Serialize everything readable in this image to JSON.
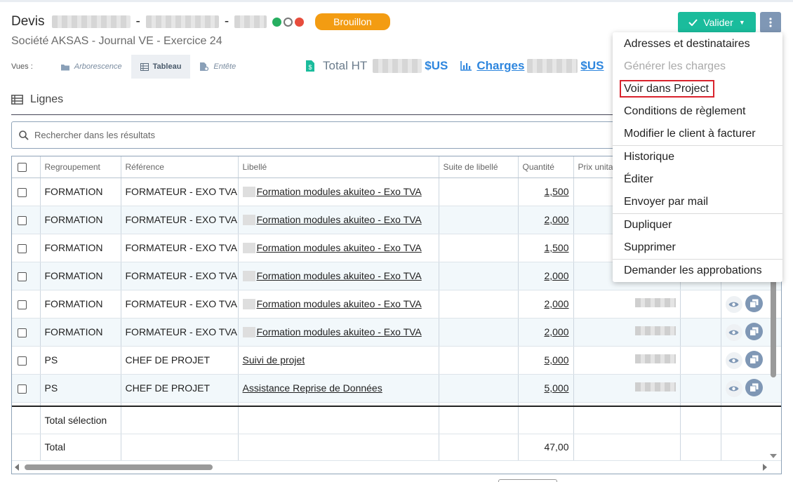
{
  "header": {
    "title_prefix": "Devis",
    "separator": "-",
    "status_badge": "Brouillon",
    "subtitle": "Société AKSAS  -  Journal VE  -  Exercice 24",
    "status_dots": [
      "#27ae60",
      "#ffffff",
      "#e74c3c"
    ]
  },
  "views": {
    "label": "Vues :",
    "items": [
      {
        "label": "Arborescence",
        "icon": "folder-icon",
        "active": false
      },
      {
        "label": "Tableau",
        "icon": "table-icon",
        "active": true
      },
      {
        "label": "Entête",
        "icon": "file-gear-icon",
        "active": false
      }
    ]
  },
  "totals": {
    "total_ht_label": "Total HT",
    "total_ht_currency": "$US",
    "charges_label": "Charges",
    "charges_currency": "$US"
  },
  "actions": {
    "valider_label": "Valider",
    "more_icon": "vertical-dots-icon"
  },
  "section": {
    "title": "Lignes"
  },
  "search": {
    "placeholder": "Rechercher dans les résultats"
  },
  "table": {
    "columns": [
      "Regroupement",
      "Référence",
      "Libellé",
      "Suite de libellé",
      "Quantité",
      "Prix unita"
    ],
    "rows": [
      {
        "groupement": "FORMATION",
        "reference": "FORMATEUR - EXO TVA",
        "libelle": "Formation modules akuiteo - Exo TVA",
        "quantite": "1,500"
      },
      {
        "groupement": "FORMATION",
        "reference": "FORMATEUR - EXO TVA",
        "libelle": "Formation modules akuiteo - Exo TVA",
        "quantite": "2,000"
      },
      {
        "groupement": "FORMATION",
        "reference": "FORMATEUR - EXO TVA",
        "libelle": "Formation modules akuiteo - Exo TVA",
        "quantite": "1,500"
      },
      {
        "groupement": "FORMATION",
        "reference": "FORMATEUR - EXO TVA",
        "libelle": "Formation modules akuiteo - Exo TVA",
        "quantite": "2,000"
      },
      {
        "groupement": "FORMATION",
        "reference": "FORMATEUR - EXO TVA",
        "libelle": "Formation modules akuiteo - Exo TVA",
        "quantite": "2,000"
      },
      {
        "groupement": "FORMATION",
        "reference": "FORMATEUR - EXO TVA",
        "libelle": "Formation modules akuiteo - Exo TVA",
        "quantite": "2,000"
      },
      {
        "groupement": "PS",
        "reference": "CHEF DE PROJET",
        "libelle": "Suivi de projet",
        "quantite": "5,000"
      },
      {
        "groupement": "PS",
        "reference": "CHEF DE PROJET",
        "libelle": "Assistance Reprise de Données",
        "quantite": "5,000"
      }
    ],
    "total_selection_label": "Total sélection",
    "total_label": "Total",
    "total_quantite": "47,00"
  },
  "menu": {
    "items": [
      {
        "label": "Adresses et destinataires",
        "disabled": false
      },
      {
        "label": "Générer les charges",
        "disabled": true
      },
      {
        "label": "Voir dans Project",
        "disabled": false,
        "highlighted": true
      },
      {
        "label": "Conditions de règlement",
        "disabled": false
      },
      {
        "label": "Modifier le client à facturer",
        "disabled": false
      },
      {
        "label": "Historique",
        "disabled": false
      },
      {
        "label": "Éditer",
        "disabled": false
      },
      {
        "label": "Envoyer par mail",
        "disabled": false
      },
      {
        "label": "Dupliquer",
        "disabled": false
      },
      {
        "label": "Supprimer",
        "disabled": false
      },
      {
        "label": "Demander les approbations",
        "disabled": false
      }
    ]
  },
  "colors": {
    "accent": "#1abc9c",
    "badge": "#f39c12",
    "link": "#2e86de",
    "highlight_border": "#d9232d"
  }
}
